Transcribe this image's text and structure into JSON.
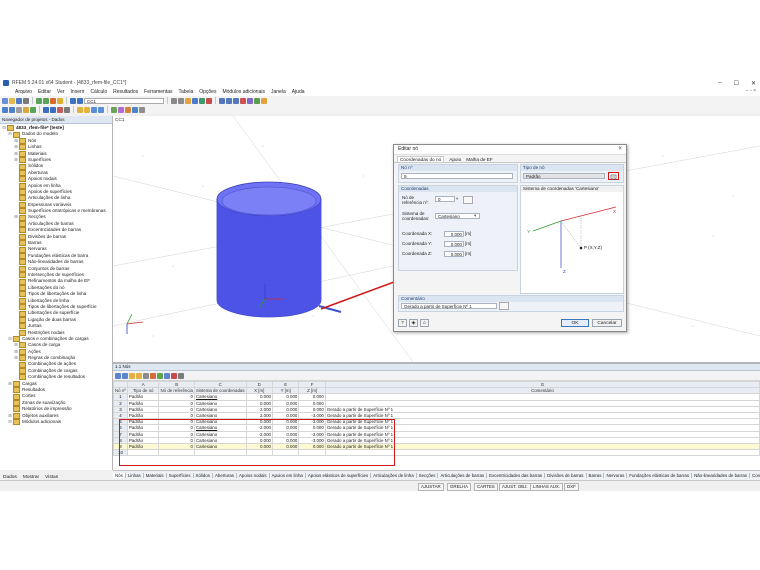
{
  "window": {
    "title": "RFEM 5.24.01 x64 Student - [4833_rfem-file_CC1*]",
    "controls": [
      "–",
      "☐",
      "✕"
    ]
  },
  "menu": {
    "items": [
      "Arquivo",
      "Editar",
      "Ver",
      "Inserir",
      "Cálculo",
      "Resultados",
      "Ferramentas",
      "Tabela",
      "Opções",
      "Módulos adicionais",
      "Janela",
      "Ajuda"
    ],
    "right": "– ▫ ×"
  },
  "toolbar": {
    "loadcase": "CC1"
  },
  "navigator": {
    "header": "Navegador de projetos - Dados",
    "items": [
      {
        "label": "4833_rfem-file* [teste]",
        "indent": 0,
        "toggle": "⊟"
      },
      {
        "label": "Dados do modelo",
        "indent": 1,
        "toggle": "⊟"
      },
      {
        "label": "Nós",
        "indent": 2,
        "toggle": "⊞"
      },
      {
        "label": "Linhas",
        "indent": 2,
        "toggle": "⊞"
      },
      {
        "label": "Materiais",
        "indent": 2,
        "toggle": "⊞"
      },
      {
        "label": "Superfícies",
        "indent": 2,
        "toggle": "⊞"
      },
      {
        "label": "Sólidos",
        "indent": 2,
        "toggle": ""
      },
      {
        "label": "Aberturas",
        "indent": 2,
        "toggle": ""
      },
      {
        "label": "Apoios nodais",
        "indent": 2,
        "toggle": ""
      },
      {
        "label": "Apoios em linha",
        "indent": 2,
        "toggle": ""
      },
      {
        "label": "Apoios de superfícies",
        "indent": 2,
        "toggle": ""
      },
      {
        "label": "Articulações de linha",
        "indent": 2,
        "toggle": ""
      },
      {
        "label": "Espessuras variáveis",
        "indent": 2,
        "toggle": ""
      },
      {
        "label": "Superfícies ortotrópicas e membranas",
        "indent": 2,
        "toggle": ""
      },
      {
        "label": "Secções",
        "indent": 2,
        "toggle": "⊞"
      },
      {
        "label": "Articulações de barras",
        "indent": 2,
        "toggle": ""
      },
      {
        "label": "Excentricidades de barras",
        "indent": 2,
        "toggle": ""
      },
      {
        "label": "Divisões de barras",
        "indent": 2,
        "toggle": ""
      },
      {
        "label": "Barras",
        "indent": 2,
        "toggle": ""
      },
      {
        "label": "Nervuras",
        "indent": 2,
        "toggle": ""
      },
      {
        "label": "Fundações elásticas de barra",
        "indent": 2,
        "toggle": ""
      },
      {
        "label": "Não-linearidades de barras",
        "indent": 2,
        "toggle": ""
      },
      {
        "label": "Conjuntos de barras",
        "indent": 2,
        "toggle": ""
      },
      {
        "label": "Intersecções de superfícies",
        "indent": 2,
        "toggle": ""
      },
      {
        "label": "Refinamentos da malha de EF",
        "indent": 2,
        "toggle": ""
      },
      {
        "label": "Libertações do nó",
        "indent": 2,
        "toggle": ""
      },
      {
        "label": "Tipos de libertações de linha",
        "indent": 2,
        "toggle": ""
      },
      {
        "label": "Libertações de linha",
        "indent": 2,
        "toggle": ""
      },
      {
        "label": "Tipos de libertações de superfície",
        "indent": 2,
        "toggle": ""
      },
      {
        "label": "Libertações de superfície",
        "indent": 2,
        "toggle": ""
      },
      {
        "label": "Ligação de duas barras",
        "indent": 2,
        "toggle": ""
      },
      {
        "label": "Juntas",
        "indent": 2,
        "toggle": ""
      },
      {
        "label": "Restrições nodais",
        "indent": 2,
        "toggle": ""
      },
      {
        "label": "Casos e combinações de cargas",
        "indent": 1,
        "toggle": "⊟"
      },
      {
        "label": "Casos de carga",
        "indent": 2,
        "toggle": "⊞"
      },
      {
        "label": "Ações",
        "indent": 2,
        "toggle": "⊞"
      },
      {
        "label": "Regras de combinação",
        "indent": 2,
        "toggle": "⊞"
      },
      {
        "label": "Combinações de ações",
        "indent": 2,
        "toggle": ""
      },
      {
        "label": "Combinações de cargas",
        "indent": 2,
        "toggle": ""
      },
      {
        "label": "Combinações de resultados",
        "indent": 2,
        "toggle": ""
      },
      {
        "label": "Cargas",
        "indent": 1,
        "toggle": "⊞"
      },
      {
        "label": "Resultados",
        "indent": 1,
        "toggle": ""
      },
      {
        "label": "Cortes",
        "indent": 1,
        "toggle": ""
      },
      {
        "label": "Zonas de suavização",
        "indent": 1,
        "toggle": ""
      },
      {
        "label": "Relatórios de impressão",
        "indent": 1,
        "toggle": ""
      },
      {
        "label": "Objetos auxiliares",
        "indent": 1,
        "toggle": "⊞"
      },
      {
        "label": "Módulos adicionais",
        "indent": 1,
        "toggle": "⊟"
      }
    ],
    "tabs": [
      "Dados",
      "Mostrar",
      "Vistas"
    ]
  },
  "viewport": {
    "label": "CC1"
  },
  "dialog": {
    "title": "Editar nó",
    "tabs": [
      "Coordenadas do nó",
      "Apoio",
      "Malha de EF"
    ],
    "node_no_label": "Nó nº",
    "node_no": "9",
    "node_type_label": "Tipo de nó",
    "node_type": "Padrão",
    "coords_group": "Coordenadas",
    "reference_label": "Nó de referência nº:",
    "reference_value": "0",
    "system_label": "Sistema de coordenadas:",
    "system_value": "Cartesiano",
    "x_label": "Coordenada X:",
    "x_value": "0.000",
    "y_label": "Coordenada Y:",
    "y_value": "0.000",
    "z_label": "Coordenada Z:",
    "z_value": "0.000",
    "unit": "[m]",
    "preview_title": "Sistema de coordenadas 'Cartesiano'",
    "preview_point": "P (X,Y,Z)",
    "comment_label": "Comentário",
    "comment_value": "Gerado a partir de Superfície Nº 1",
    "ok": "OK",
    "cancel": "Cancelar"
  },
  "table": {
    "title": "1.1 Nós",
    "col_letters": [
      "A",
      "B",
      "C",
      "D",
      "E",
      "F",
      "G"
    ],
    "col_group": "Coordenadas do nó",
    "headers": [
      "Nó nº",
      "Tipo de nó",
      "Nó de referência",
      "Sistema de coordenadas",
      "X [m]",
      "Y [m]",
      "Z [m]",
      "Comentário"
    ],
    "rows": [
      [
        "1",
        "Padrão",
        "0",
        "Cartesiano",
        "0.000",
        "0.000",
        "0.000",
        ""
      ],
      [
        "2",
        "Padrão",
        "0",
        "Cartesiano",
        "0.000",
        "0.000",
        "0.000",
        ""
      ],
      [
        "3",
        "Padrão",
        "0",
        "Cartesiano",
        "2.000",
        "0.000",
        "0.000",
        "Gerado a partir de Superfície Nº 1"
      ],
      [
        "4",
        "Padrão",
        "0",
        "Cartesiano",
        "2.000",
        "0.000",
        "-3.000",
        "Gerado a partir de Superfície Nº 1"
      ],
      [
        "5",
        "Padrão",
        "0",
        "Cartesiano",
        "0.000",
        "0.000",
        "-3.000",
        "Gerado a partir de Superfície Nº 1"
      ],
      [
        "6",
        "Padrão",
        "0",
        "Cartesiano",
        "-2.000",
        "0.000",
        "0.000",
        "Gerado a partir de Superfície Nº 1"
      ],
      [
        "7",
        "Padrão",
        "0",
        "Cartesiano",
        "-2.000",
        "0.000",
        "-3.000",
        "Gerado a partir de Superfície Nº 1"
      ],
      [
        "8",
        "Padrão",
        "0",
        "Cartesiano",
        "0.000",
        "0.000",
        "-3.000",
        "Gerado a partir de Superfície Nº 1"
      ],
      [
        "9",
        "Padrão",
        "0",
        "Cartesiano",
        "0.000",
        "0.000",
        "0.000",
        "Gerado a partir de Superfície Nº 1"
      ],
      [
        "10",
        "",
        "",
        "",
        "",
        "",
        "",
        ""
      ]
    ]
  },
  "sheet_tabs": [
    "Nós",
    "Linhas",
    "Materiais",
    "Superfícies",
    "Sólidos",
    "Aberturas",
    "Apoios nodais",
    "Apoios em linha",
    "Apoios elásticos de superfícies",
    "Articulações de linha",
    "Secções",
    "Articulações de barras",
    "Excentricidades das barras",
    "Divisões de barras",
    "Barras",
    "Nervuras",
    "Fundações elásticas de barras",
    "Não-linearidades de barras",
    "Conjuntos de barras"
  ],
  "status": [
    "AJUSTAR",
    "GRELHA",
    "CARTES",
    "AJUST. OBJ.",
    "LINHAS AUX.",
    "DXF"
  ],
  "colors": {
    "accent": "#4a55e0",
    "arrow": "#d01818",
    "highlight": "#d01818"
  }
}
